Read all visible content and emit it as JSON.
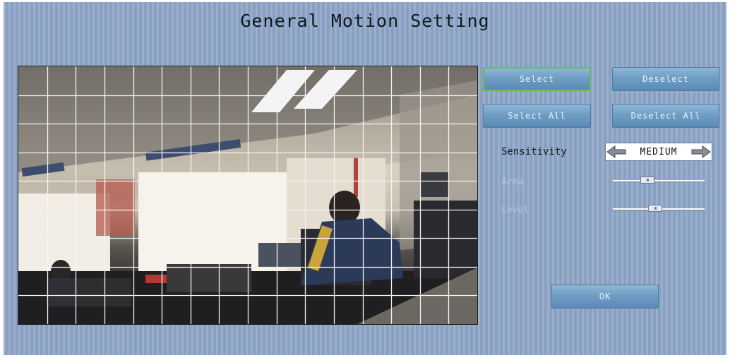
{
  "title": "General Motion Setting",
  "buttons": {
    "select": "Select",
    "deselect": "Deselect",
    "select_all": "Select All",
    "deselect_all": "Deselect All",
    "ok": "OK"
  },
  "settings": {
    "sensitivity_label": "Sensitivity",
    "sensitivity_value": "MEDIUM",
    "area_label": "Area",
    "area_value": 0.35,
    "level_label": "Level",
    "level_value": 0.45
  },
  "grid": {
    "columns": 16,
    "rows": 9
  },
  "colors": {
    "panel": "#8fa6c8",
    "button": "#6f9ec4",
    "active_border": "#5fc24a"
  }
}
